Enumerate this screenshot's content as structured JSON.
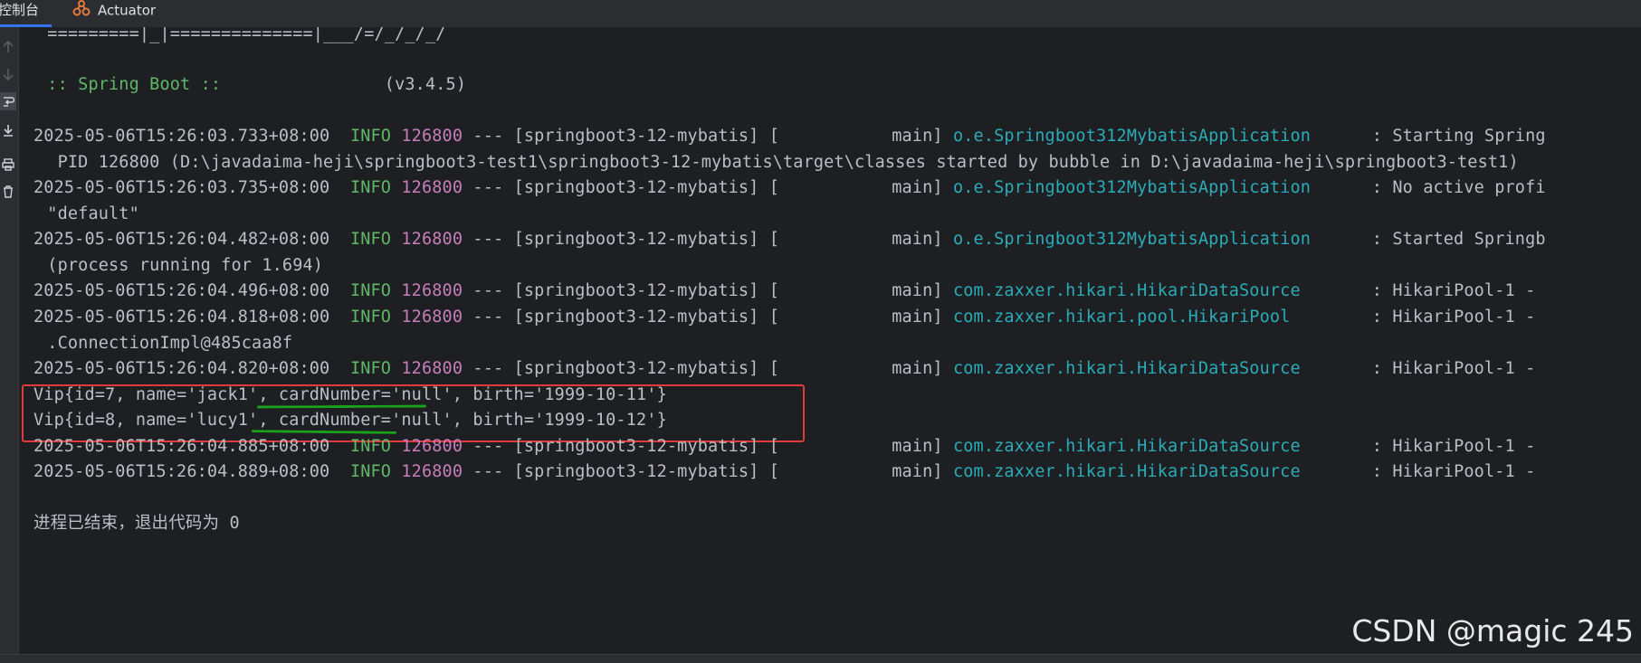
{
  "tabs": [
    {
      "label": "控制台",
      "active": true
    },
    {
      "label": "Actuator",
      "active": false,
      "icon": "actuator-icon"
    }
  ],
  "gutter_icons": [
    "arrow-up-icon",
    "arrow-down-icon",
    "soft-wrap-icon",
    "scroll-to-end-icon",
    "print-icon",
    "trash-icon"
  ],
  "console": {
    "banner_line": " =========|_|==============|___/=/_/_/_/",
    "spring_prefix": " :: Spring Boot :: ",
    "spring_version": "               (v3.4.5)",
    "logs": [
      {
        "ts": "2025-05-06T15:26:03.733+08:00",
        "level": "INFO",
        "pid": "126800",
        "thread": " --- [springboot3-12-mybatis] [           main] ",
        "logger": "o.e.Springboot312MybatisApplication",
        "msg": "      : Starting Spring"
      },
      {
        "ts": "2025-05-06T15:26:03.735+08:00",
        "level": "INFO",
        "pid": "126800",
        "thread": " --- [springboot3-12-mybatis] [           main] ",
        "logger": "o.e.Springboot312MybatisApplication",
        "msg": "      : No active profi"
      },
      {
        "ts": "2025-05-06T15:26:04.482+08:00",
        "level": "INFO",
        "pid": "126800",
        "thread": " --- [springboot3-12-mybatis] [           main] ",
        "logger": "o.e.Springboot312MybatisApplication",
        "msg": "      : Started Springb"
      },
      {
        "ts": "2025-05-06T15:26:04.496+08:00",
        "level": "INFO",
        "pid": "126800",
        "thread": " --- [springboot3-12-mybatis] [           main] ",
        "logger": "com.zaxxer.hikari.HikariDataSource",
        "msg": "       : HikariPool-1 -"
      },
      {
        "ts": "2025-05-06T15:26:04.818+08:00",
        "level": "INFO",
        "pid": "126800",
        "thread": " --- [springboot3-12-mybatis] [           main] ",
        "logger": "com.zaxxer.hikari.pool.HikariPool",
        "msg": "        : HikariPool-1 -"
      },
      {
        "ts": "2025-05-06T15:26:04.820+08:00",
        "level": "INFO",
        "pid": "126800",
        "thread": " --- [springboot3-12-mybatis] [           main] ",
        "logger": "com.zaxxer.hikari.HikariDataSource",
        "msg": "       : HikariPool-1 -"
      },
      {
        "ts": "2025-05-06T15:26:04.885+08:00",
        "level": "INFO",
        "pid": "126800",
        "thread": " --- [springboot3-12-mybatis] [           main] ",
        "logger": "com.zaxxer.hikari.HikariDataSource",
        "msg": "       : HikariPool-1 -"
      },
      {
        "ts": "2025-05-06T15:26:04.889+08:00",
        "level": "INFO",
        "pid": "126800",
        "thread": " --- [springboot3-12-mybatis] [           main] ",
        "logger": "com.zaxxer.hikari.HikariDataSource",
        "msg": "       : HikariPool-1 -"
      }
    ],
    "continuations": [
      "  PID 126800 (D:\\javadaima-heji\\springboot3-test1\\springboot3-12-mybatis\\target\\classes started by bubble in D:\\javadaima-heji\\springboot3-test1)",
      " \"default\"",
      " (process running for 1.694)",
      " .ConnectionImpl@485caa8f"
    ],
    "vip_lines": [
      "Vip{id=7, name='jack1', cardNumber='null', birth='1999-10-11'}",
      "Vip{id=8, name='lucy1', cardNumber='null', birth='1999-10-12'}"
    ],
    "exit_message": "进程已结束，退出代码为 0"
  },
  "watermark": "CSDN @magic 245",
  "colors": {
    "background": "#1e1f22",
    "text": "#bcbec4",
    "info": "#5fb865",
    "pid": "#c77dbb",
    "logger": "#2aacb8",
    "highlight_box": "#e03a3a",
    "underline": "#1aa31a"
  }
}
